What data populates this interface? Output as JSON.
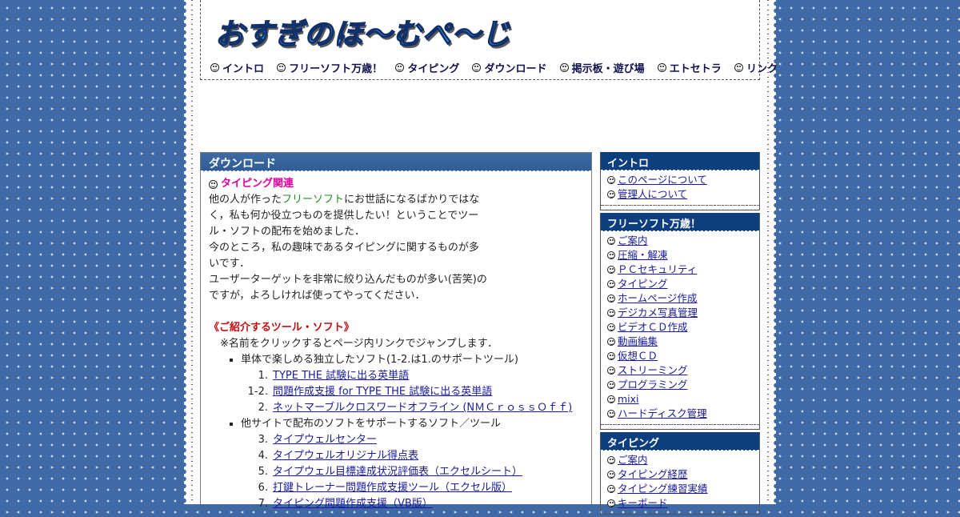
{
  "site": {
    "logo": "おすぎのほ～むぺ～じ"
  },
  "nav": [
    "イントロ",
    "フリーソフト万歳！",
    "タイピング",
    "ダウンロード",
    "掲示板・遊び場",
    "エトセトラ",
    "リンク"
  ],
  "main": {
    "title": "ダウンロード",
    "section_title": "タイピング関連",
    "intro": {
      "p1_a": "他の人が作った",
      "p1_link": "フリーソフト",
      "p1_b": "にお世話になるばかりではな",
      "p1_c": "く，私も何か役立つものを提供したい！ということでツー",
      "p1_d": "ル・ソフトの配布を始めました．",
      "p2_a": "今のところ，私の趣味であるタイピングに関するものが多",
      "p2_b": "いです．",
      "p3_a": "ユーザーターゲットを非常に絞り込んだものが多い(苦笑)の",
      "p3_b": "ですが，よろしければ使ってやってください．"
    },
    "tools_title": "《ご紹介するツール・ソフト》",
    "tools_note": "※名前をクリックするとページ内リンクでジャンプします．",
    "group1": "単体で楽しめる独立したソフト(1-2.は1.のサポートツール)",
    "group1_items": [
      {
        "n": "1.",
        "label": "TYPE THE 試験に出る英単語"
      },
      {
        "n": "1-2.",
        "label": "問題作成支援 for TYPE THE 試験に出る英単語"
      },
      {
        "n": "2.",
        "label": "ネットマーブルクロスワードオフライン (NＭＣｒｏｓｓＯｆｆ)"
      }
    ],
    "group2": "他サイトで配布のソフトをサポートするソフト／ツール",
    "group2_items": [
      {
        "n": "3.",
        "label": "タイプウェルセンター"
      },
      {
        "n": "4.",
        "label": "タイプウェルオリジナル得点表"
      },
      {
        "n": "5.",
        "label": "タイプウェル目標達成状況評価表（エクセルシート）"
      },
      {
        "n": "6.",
        "label": "打鍵トレーナー問題作成支援ツール（エクセル版）"
      },
      {
        "n": "7.",
        "label": "タイピング問題作成支援（VB版）"
      }
    ]
  },
  "sidebar": [
    {
      "title": "イントロ",
      "items": [
        "このページについて",
        "管理人について"
      ]
    },
    {
      "title": "フリーソフト万歳！",
      "items": [
        "ご案内",
        "圧縮・解凍",
        "ＰＣセキュリティ",
        "タイピング",
        "ホームページ作成",
        "デジカメ写真管理",
        "ビデオＣＤ作成",
        "動画編集",
        "仮想ＣＤ",
        "ストリーミング",
        "プログラミング",
        "mixi",
        "ハードディスク管理"
      ]
    },
    {
      "title": "タイピング",
      "items": [
        "ご案内",
        "タイピング経歴",
        "タイピング練習実績",
        "キーボード"
      ]
    }
  ],
  "colors": {
    "background": "#3f6aa5",
    "panel_header": "#3c6aa3",
    "sidebar_header": "#0d3f7f",
    "section_title": "#e000a0",
    "tools_title": "#c01010",
    "link": "#1a1a9a"
  }
}
